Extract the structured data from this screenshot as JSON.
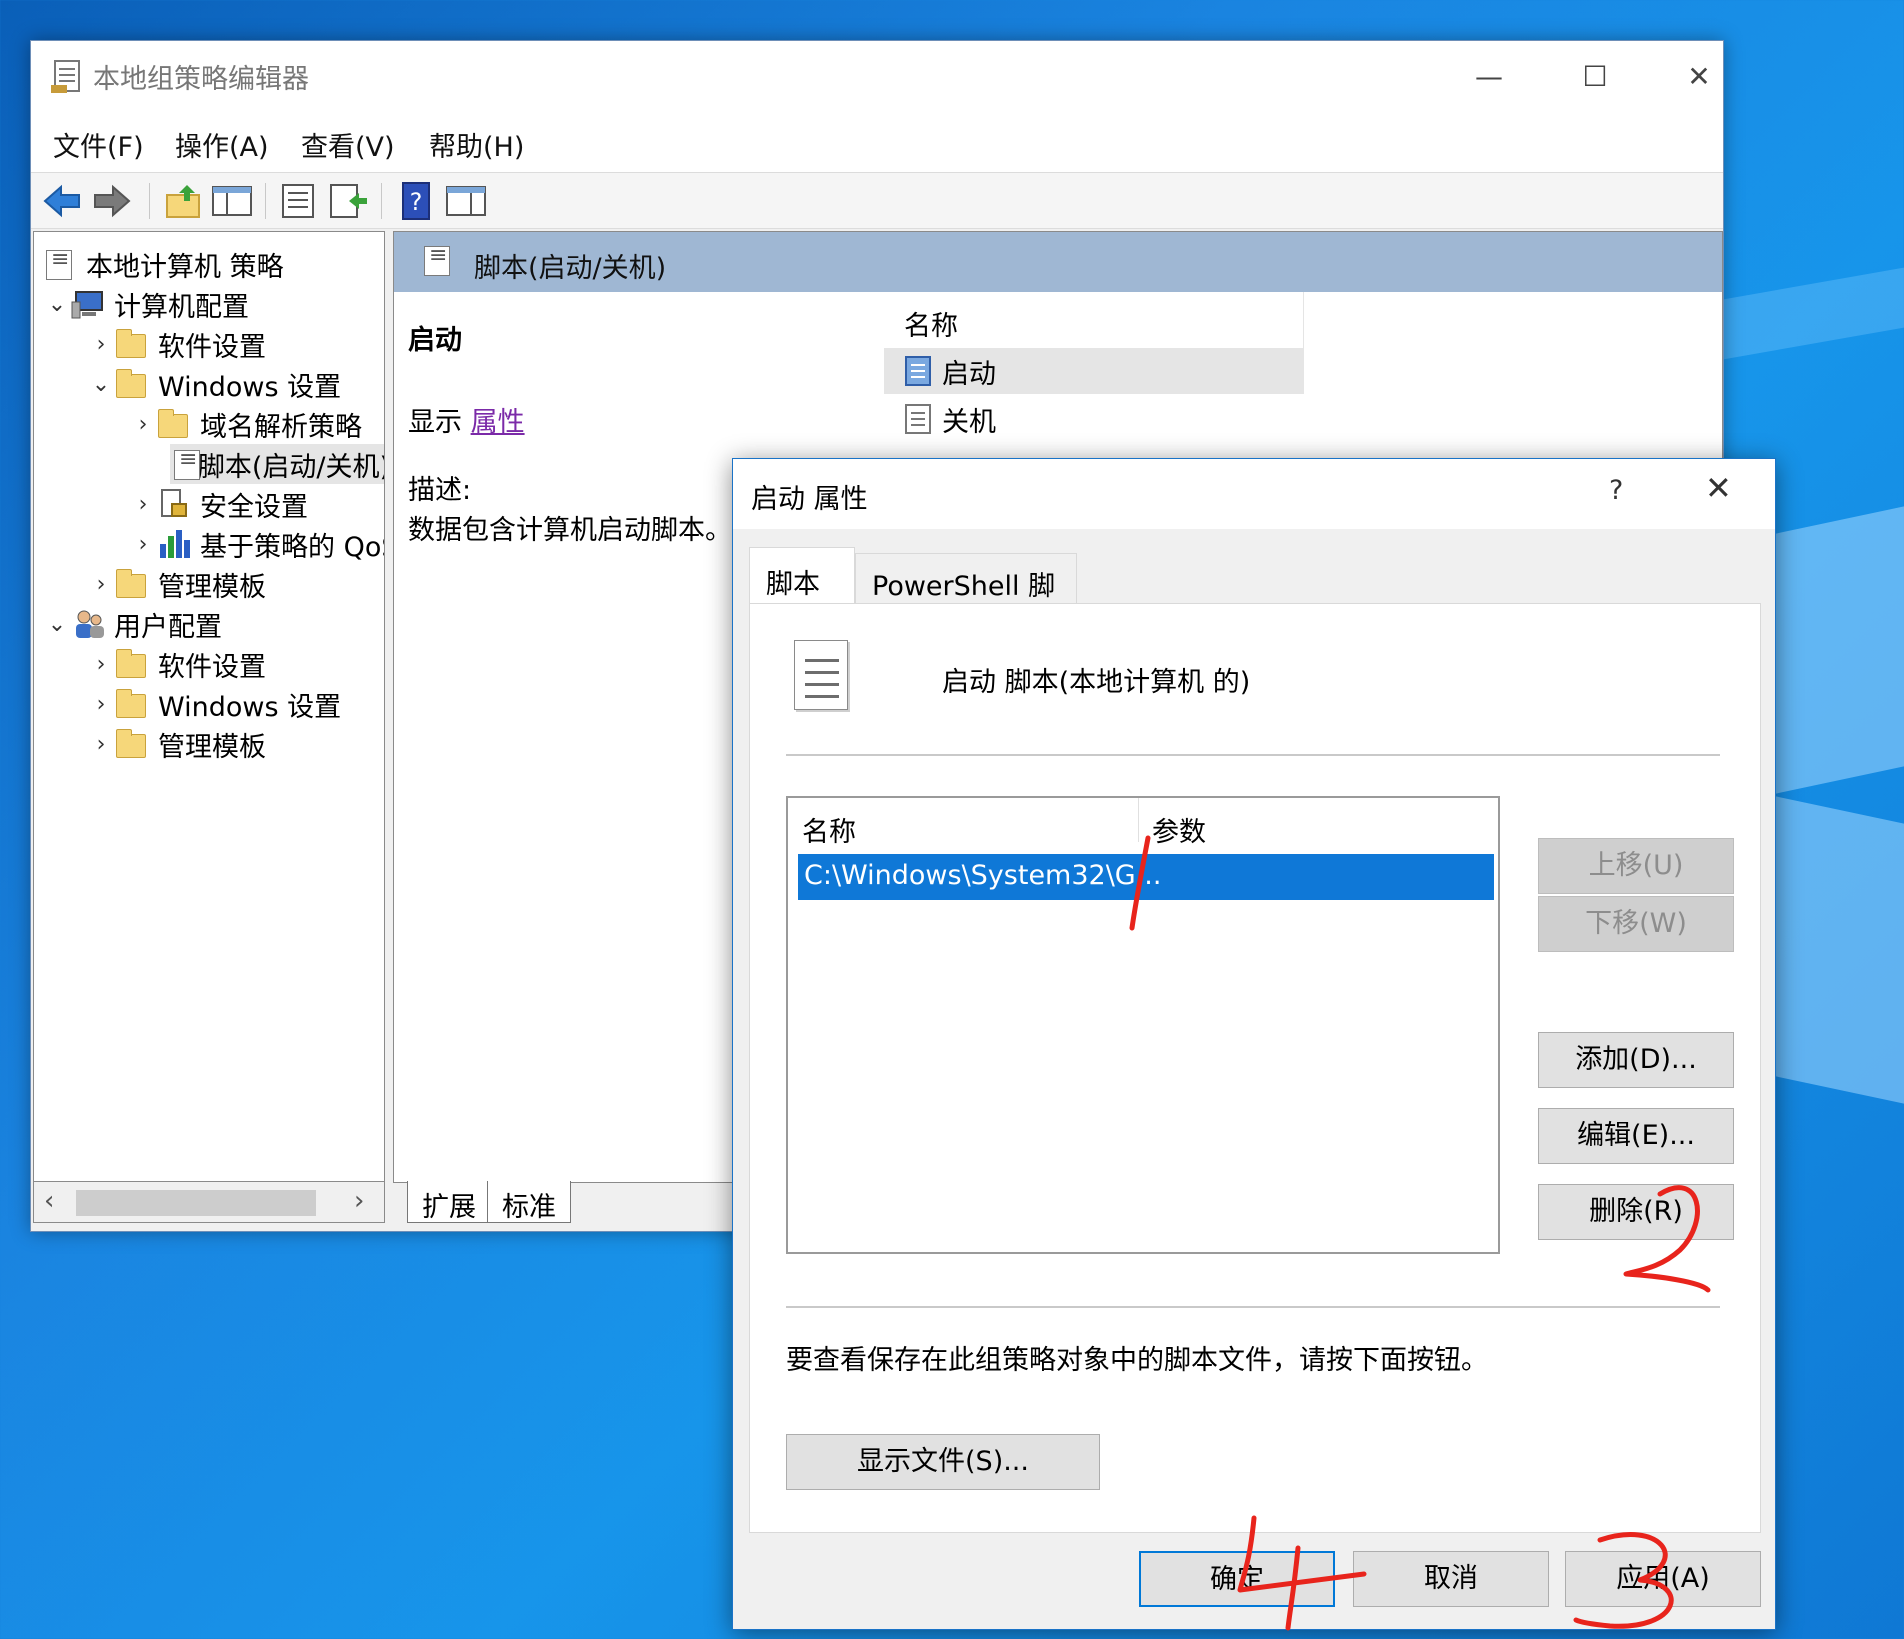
{
  "mmc": {
    "title": "本地组策略编辑器",
    "window_controls": {
      "minimize": "—",
      "maximize": "☐",
      "close": "✕"
    },
    "menu": [
      "文件(F)",
      "操作(A)",
      "查看(V)",
      "帮助(H)"
    ],
    "tree": {
      "root": "本地计算机 策略",
      "computer": "计算机配置",
      "c_software": "软件设置",
      "c_windows": "Windows 设置",
      "dns": "域名解析策略",
      "scripts": "脚本(启动/关机)",
      "security": "安全设置",
      "qos": "基于策略的 QoS",
      "c_admin": "管理模板",
      "user": "用户配置",
      "u_software": "软件设置",
      "u_windows": "Windows 设置",
      "u_admin": "管理模板"
    },
    "detail": {
      "header": "脚本(启动/关机)",
      "ext_title": "启动",
      "show_label": "显示",
      "show_link": "属性",
      "desc_label": "描述:",
      "desc": "数据包含计算机启动脚本。",
      "col_name": "名称",
      "items": [
        "启动",
        "关机"
      ]
    },
    "view_tabs": [
      "扩展",
      "标准"
    ]
  },
  "dialog": {
    "title": "启动 属性",
    "help": "?",
    "close": "✕",
    "tabs": [
      "脚本",
      "PowerShell 脚本"
    ],
    "heading": "启动 脚本(本地计算机 的)",
    "col_name": "名称",
    "col_params": "参数",
    "row_name": "C:\\Windows\\System32\\G...",
    "buttons": {
      "up": "上移(U)",
      "down": "下移(W)",
      "add": "添加(D)...",
      "edit": "编辑(E)...",
      "remove": "删除(R)",
      "show_files": "显示文件(S)...",
      "ok": "确定",
      "cancel": "取消",
      "apply": "应用(A)"
    },
    "note": "要查看保存在此组策略对象中的脚本文件，请按下面按钮。"
  },
  "colors": {
    "selection_blue": "#0f78d7",
    "header_blue": "#9fb7d3",
    "annotation_red": "#e8241c"
  }
}
